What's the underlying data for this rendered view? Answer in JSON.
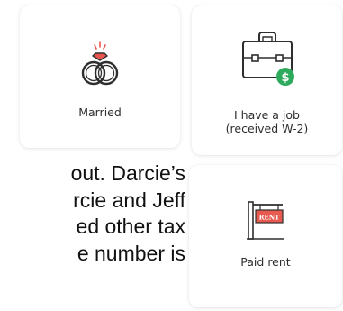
{
  "cards": {
    "married": {
      "label": "Married",
      "icon": "wedding-rings-icon"
    },
    "job": {
      "label_line1": "I have a job",
      "label_line2": "(received W-2)",
      "icon": "briefcase-dollar-icon"
    },
    "rent": {
      "label": "Paid rent",
      "icon": "rent-sign-icon",
      "sign_text": "RENT"
    }
  },
  "body_text": {
    "lines": [
      "out. Darcie’s",
      "rcie and Jeff",
      "ed other tax",
      "e number is"
    ]
  },
  "colors": {
    "accent_green": "#2eaa5c",
    "rent_red": "#e85a4f",
    "gem_red": "#e8554e"
  }
}
